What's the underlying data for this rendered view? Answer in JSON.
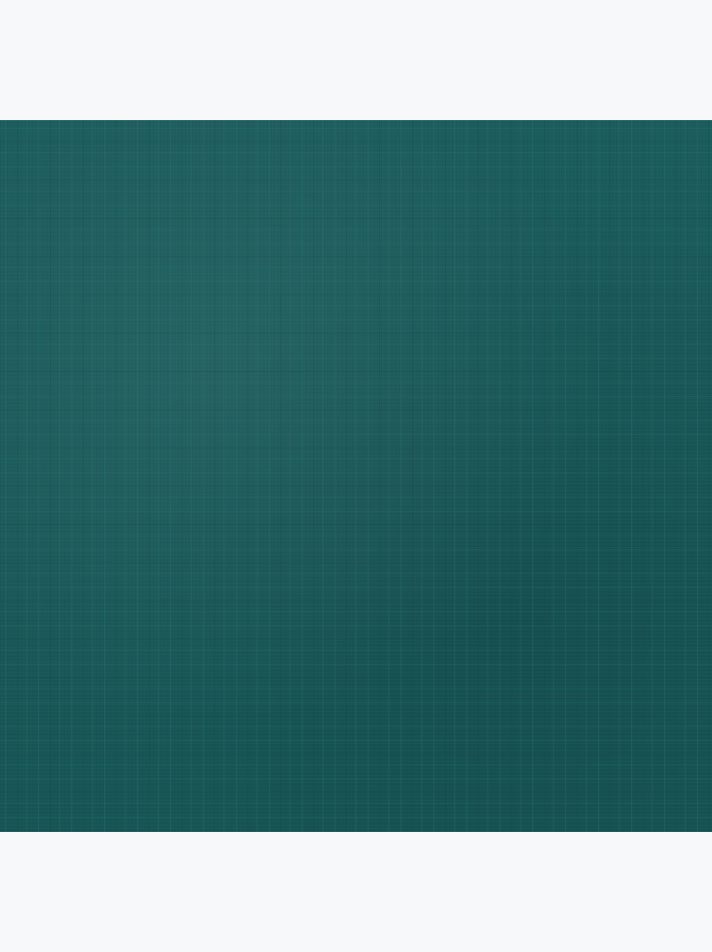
{
  "image": {
    "subject": "fabric-swatch",
    "colors": {
      "background": "#f7f8fa",
      "fabric": "#1a5a5a",
      "fabric_light_thread": "#2a6e6d",
      "fabric_dark_thread": "#124848"
    }
  }
}
